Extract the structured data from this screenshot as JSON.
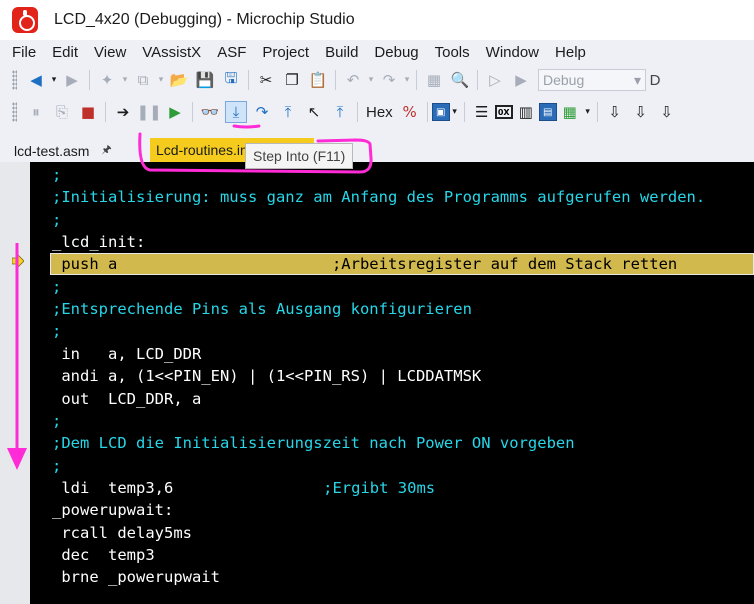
{
  "window": {
    "title": "LCD_4x20 (Debugging) - Microchip Studio"
  },
  "menu": [
    "File",
    "Edit",
    "View",
    "VAssistX",
    "ASF",
    "Project",
    "Build",
    "Debug",
    "Tools",
    "Window",
    "Help"
  ],
  "toolbar": {
    "config_value": "Debug",
    "config_overflow": "D",
    "hex_label": "Hex"
  },
  "tabs": [
    {
      "label": "lcd-test.asm",
      "pin": "🖈"
    },
    {
      "label": "Lcd-routines.inc"
    }
  ],
  "tooltip": {
    "text": "Step Into (F11)"
  },
  "editor": {
    "lines": [
      {
        "text": ";",
        "kind": "comment"
      },
      {
        "text": ";Initialisierung: muss ganz am Anfang des Programms aufgerufen werden.",
        "kind": "comment"
      },
      {
        "text": ";",
        "kind": "comment"
      },
      {
        "text": "_lcd_init:",
        "kind": "code"
      },
      {
        "text": " push a                       ;Arbeitsregister auf dem Stack retten",
        "kind": "current"
      },
      {
        "text": ";",
        "kind": "comment"
      },
      {
        "text": ";Entsprechende Pins als Ausgang konfigurieren",
        "kind": "comment"
      },
      {
        "text": ";",
        "kind": "comment"
      },
      {
        "text": " in   a, LCD_DDR",
        "kind": "code"
      },
      {
        "text": " andi a, (1<<PIN_EN) | (1<<PIN_RS) | LCDDATMSK",
        "kind": "code"
      },
      {
        "text": " out  LCD_DDR, a",
        "kind": "code"
      },
      {
        "text": ";",
        "kind": "comment"
      },
      {
        "text": ";Dem LCD die Initialisierungszeit nach Power ON vorgeben",
        "kind": "comment"
      },
      {
        "text": ";",
        "kind": "comment"
      },
      {
        "text": " ldi  temp3,6",
        "kind": "code",
        "comment": ";Ergibt 30ms"
      },
      {
        "text": "_powerupwait:",
        "kind": "code"
      },
      {
        "text": " rcall delay5ms",
        "kind": "code"
      },
      {
        "text": " dec  temp3",
        "kind": "code"
      },
      {
        "text": " brne _powerupwait",
        "kind": "code"
      }
    ]
  },
  "colors": {
    "comment": "#27d6e8",
    "current_line": "#d2b94e",
    "active_tab": "#f5cc1d",
    "annotation": "#ff2bd6"
  }
}
